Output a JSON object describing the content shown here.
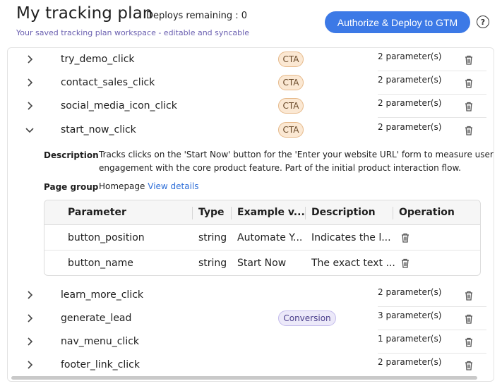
{
  "header": {
    "title": "My tracking plan",
    "deploys": "Deploys remaining : 0",
    "subtitle": "Your saved tracking plan workspace - editable and syncable",
    "deploy_button": "Authorize & Deploy to GTM",
    "help": "?"
  },
  "events": [
    {
      "name": "try_demo_click",
      "badge": "CTA",
      "params": "2 parameter(s)",
      "expanded": false
    },
    {
      "name": "contact_sales_click",
      "badge": "CTA",
      "params": "2 parameter(s)",
      "expanded": false
    },
    {
      "name": "social_media_icon_click",
      "badge": "CTA",
      "params": "2 parameter(s)",
      "expanded": false
    },
    {
      "name": "start_now_click",
      "badge": "CTA",
      "params": "2 parameter(s)",
      "expanded": true
    },
    {
      "name": "learn_more_click",
      "badge": "",
      "params": "2 parameter(s)",
      "expanded": false
    },
    {
      "name": "generate_lead",
      "badge": "Conversion",
      "params": "3 parameter(s)",
      "expanded": false
    },
    {
      "name": "nav_menu_click",
      "badge": "",
      "params": "1 parameter(s)",
      "expanded": false
    },
    {
      "name": "footer_link_click",
      "badge": "",
      "params": "2 parameter(s)",
      "expanded": false
    }
  ],
  "detail": {
    "description_label": "Description",
    "description_line1": "Tracks clicks on the 'Start Now' button for the 'Enter your website URL' form to measure user",
    "description_line2": "engagement with the core product feature. Part of the initial product interaction flow.",
    "page_group_label": "Page group",
    "page_group": "Homepage",
    "view_details": "View details",
    "columns": [
      "Parameter",
      "Type",
      "Example v...",
      "Description",
      "Operation"
    ],
    "rows": [
      {
        "parameter": "button_position",
        "type": "string",
        "example": "Automate Y...",
        "description": "Indicates the l..."
      },
      {
        "parameter": "button_name",
        "type": "string",
        "example": "Start Now",
        "description": "The exact text ..."
      }
    ]
  },
  "colors": {
    "accent": "#3c79e6",
    "cta_bg": "#fbe8d3",
    "conversion_bg": "#ece9f9",
    "link": "#2f6fd8"
  }
}
